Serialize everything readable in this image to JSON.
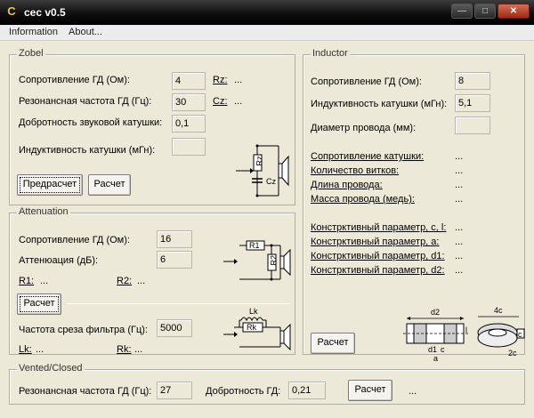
{
  "window": {
    "icon": "C",
    "title": "cec v0.5",
    "minimize_label": "—",
    "maximize_label": "□",
    "close_label": "✕"
  },
  "menu": [
    "Information",
    "About..."
  ],
  "zobel": {
    "title": "Zobel",
    "resistance_label": "Сопротивление ГД (Ом):",
    "resistance_value": "4",
    "resonance_label": "Резонансная частота ГД (Гц):",
    "resonance_value": "30",
    "quality_label": "Добротность звуковой катушки:",
    "quality_value": "0,1",
    "inductance_label": "Индуктивность катушки (мГн):",
    "inductance_value": "",
    "rz_label": "Rz:",
    "rz_value": "...",
    "cz_label": "Cz:",
    "cz_value": "...",
    "precalc_button": "Предрасчет",
    "calc_button": "Расчет",
    "diagram": {
      "r_label": "Rz",
      "c_label": "Cz"
    }
  },
  "attenuation": {
    "title": "Attenuation",
    "resistance_label": "Сопротивление ГД (Ом):",
    "resistance_value": "16",
    "attenuation_label": "Аттенюация (дБ):",
    "attenuation_value": "6",
    "r1_label": "R1:",
    "r1_value": "...",
    "r2_label": "R2:",
    "r2_value": "...",
    "calc_button": "Расчет",
    "cutoff_label": "Частота среза фильтра (Гц):",
    "cutoff_value": "5000",
    "lk_label": "Lk:",
    "lk_value": "...",
    "rk_label": "Rk:",
    "rk_value": "...",
    "diagram": {
      "r1": "R1",
      "r2": "R2",
      "lk": "Lk",
      "rk": "Rk"
    }
  },
  "inductor": {
    "title": "Inductor",
    "resistance_label": "Сопротивление ГД (Ом):",
    "resistance_value": "8",
    "inductance_label": "Индуктивность катушки (мГн):",
    "inductance_value": "5,1",
    "wire_diameter_label": "Диаметр провода (мм):",
    "wire_diameter_value": "",
    "results": [
      {
        "label": "Сопротивление катушки:",
        "value": "..."
      },
      {
        "label": "Количество витков:",
        "value": "..."
      },
      {
        "label": "Длина провода:",
        "value": "..."
      },
      {
        "label": "Масса провода (медь):",
        "value": "..."
      }
    ],
    "params": [
      {
        "label": "Констрктивный параметр, c, l:",
        "value": "..."
      },
      {
        "label": "Констрктивный параметр, a:",
        "value": "..."
      },
      {
        "label": "Констрктивный параметр, d1:",
        "value": "..."
      },
      {
        "label": "Констрктивный параметр, d2:",
        "value": "..."
      }
    ],
    "calc_button": "Расчет",
    "diagram": {
      "d2": "d2",
      "d1": "d1",
      "c": "c",
      "a": "a",
      "l": "l",
      "c4": "4c",
      "c2": "2c",
      "cc": "c"
    }
  },
  "vented": {
    "title": "Vented/Closed",
    "resonance_label": "Резонансная частота ГД (Гц):",
    "resonance_value": "27",
    "quality_label": "Добротность ГД:",
    "quality_value": "0,21",
    "calc_button": "Расчет",
    "result": "..."
  }
}
